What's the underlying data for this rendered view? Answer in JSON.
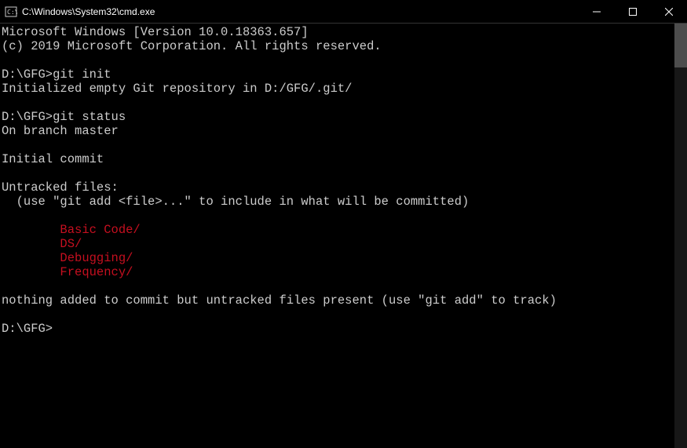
{
  "titlebar": {
    "title": "C:\\Windows\\System32\\cmd.exe"
  },
  "terminal": {
    "line1": "Microsoft Windows [Version 10.0.18363.657]",
    "line2": "(c) 2019 Microsoft Corporation. All rights reserved.",
    "blank1": "",
    "prompt1": "D:\\GFG>",
    "cmd1": "git init",
    "out1": "Initialized empty Git repository in D:/GFG/.git/",
    "blank2": "",
    "prompt2": "D:\\GFG>",
    "cmd2": "git status",
    "status_branch": "On branch master",
    "blank3": "",
    "status_initial": "Initial commit",
    "blank4": "",
    "untracked_header": "Untracked files:",
    "untracked_hint": "  (use \"git add <file>...\" to include in what will be committed)",
    "blank5": "",
    "file1": "        Basic Code/",
    "file2": "        DS/",
    "file3": "        Debugging/",
    "file4": "        Frequency/",
    "blank6": "",
    "nothing_added": "nothing added to commit but untracked files present (use \"git add\" to track)",
    "blank7": "",
    "prompt3": "D:\\GFG>"
  }
}
